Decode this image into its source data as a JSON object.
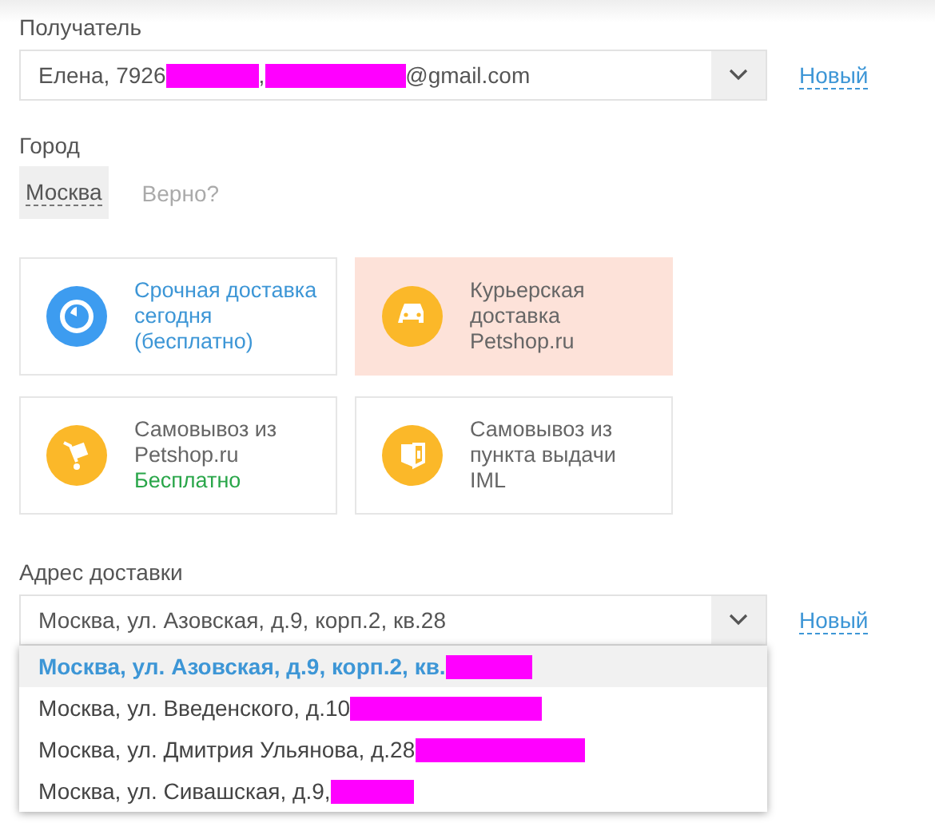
{
  "recipient": {
    "label": "Получатель",
    "value_parts": [
      "Елена, 7926",
      ",",
      "@gmail.com"
    ],
    "new_link": "Новый"
  },
  "city": {
    "label": "Город",
    "value": "Москва",
    "confirm": "Верно?"
  },
  "delivery_options": [
    {
      "kind": "urgent",
      "lines": [
        "Срочная доставка",
        "сегодня",
        "(бесплатно)"
      ],
      "selected": false,
      "highlight_text": true
    },
    {
      "kind": "courier",
      "lines": [
        "Курьерская",
        "доставка",
        "Petshop.ru"
      ],
      "selected": true,
      "highlight_text": false
    },
    {
      "kind": "pickup",
      "lines": [
        "Самовывоз из",
        "Petshop.ru"
      ],
      "note": "Бесплатно",
      "selected": false,
      "highlight_text": false
    },
    {
      "kind": "point",
      "lines": [
        "Самовывоз из",
        "пункта выдачи",
        "IML"
      ],
      "selected": false,
      "highlight_text": false
    }
  ],
  "address": {
    "label": "Адрес доставки",
    "value": "Москва, ул. Азовская, д.9, корп.2, кв.28",
    "new_link": "Новый",
    "options": [
      {
        "text": "Москва, ул. Азовская, д.9, корп.2, кв.",
        "selected": true
      },
      {
        "text": "Москва, ул. Введенского, д.10",
        "selected": false
      },
      {
        "text": "Москва, ул. Дмитрия Ульянова, д.28",
        "selected": false
      },
      {
        "text": "Москва, ул. Сивашская, д.9, ",
        "selected": false
      }
    ]
  }
}
